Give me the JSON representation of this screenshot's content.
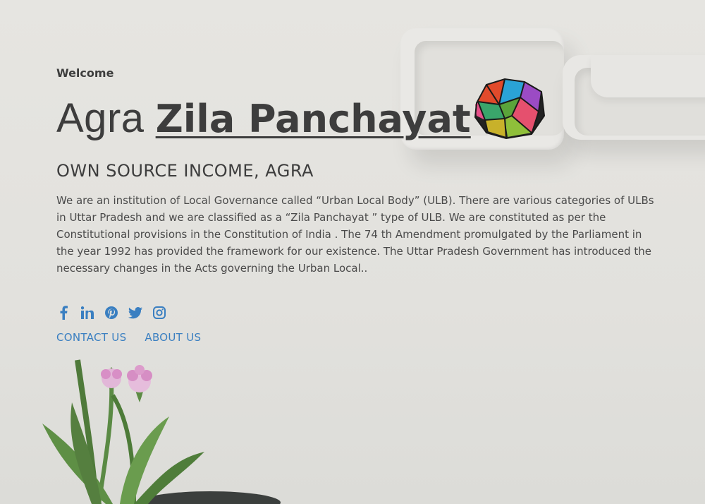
{
  "hero": {
    "welcome": "Welcome",
    "title_light": "Agra",
    "title_bold": "Zila Panchayat",
    "subtitle": "OWN SOURCE INCOME, AGRA",
    "description": "We are an institution of Local Governance called “Urban Local Body” (ULB). There are various categories of ULBs in Uttar Pradesh and we are classified as a “Zila Panchayat ” type of ULB. We are constituted as per the Constitutional provisions in the Constitution of India . The 74 th Amendment promulgated by the Parliament in the year 1992 has provided the framework for our existence. The Uttar Pradesh Government has introduced the necessary changes in the Acts governing the Urban Local.."
  },
  "social": [
    "facebook-icon",
    "linkedin-icon",
    "pinterest-icon",
    "twitter-icon",
    "instagram-icon"
  ],
  "links": {
    "contact": "CONTACT US",
    "about": "ABOUT US"
  },
  "colors": {
    "link": "#3a7fc1",
    "text": "#3d3d3d",
    "background": "#e3e2de"
  }
}
